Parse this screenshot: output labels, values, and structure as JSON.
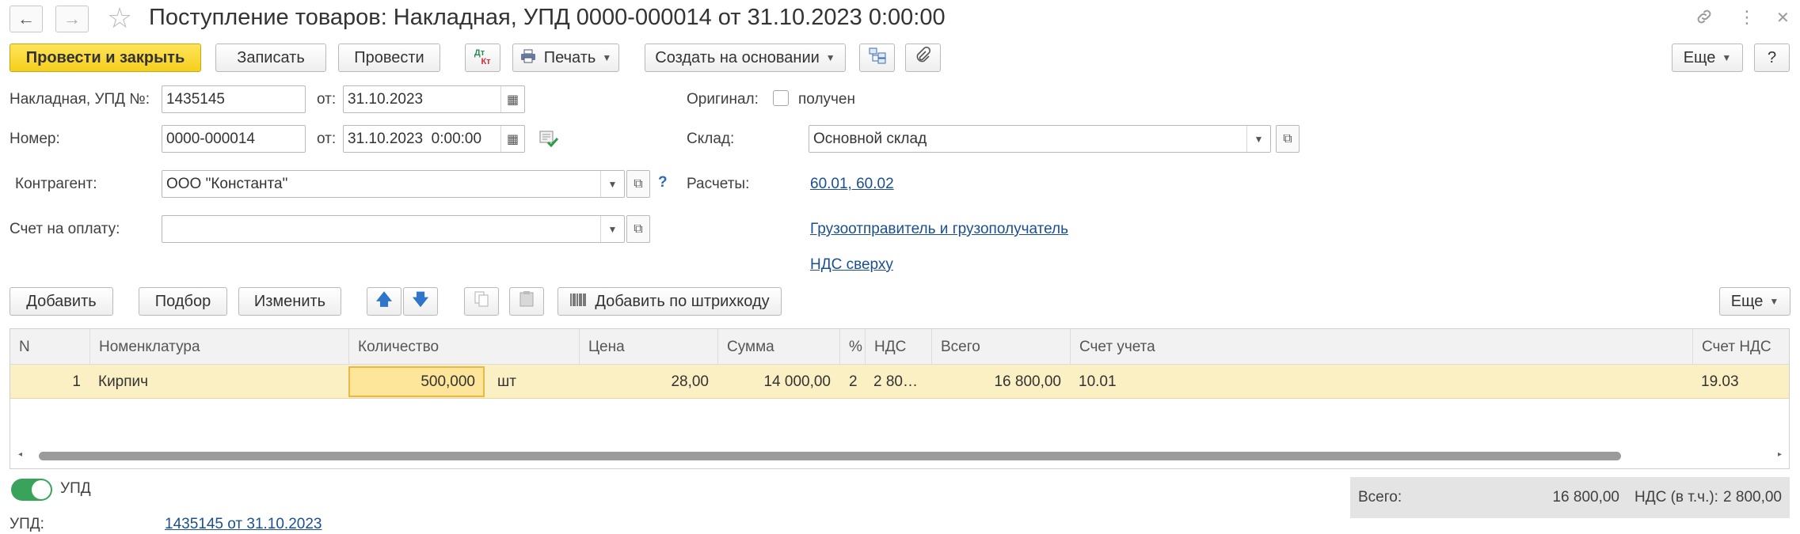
{
  "window": {
    "title": "Поступление товаров: Накладная, УПД 0000-000014 от 31.10.2023 0:00:00",
    "back_icon": "←",
    "forward_icon": "→",
    "star_icon": "☆",
    "link_icon": "🔗",
    "menu_icon": "⋮",
    "close_icon": "✕"
  },
  "toolbar": {
    "post_and_close": "Провести и закрыть",
    "save": "Записать",
    "post": "Провести",
    "dtkt_top": "Дт",
    "dtkt_bottom": "Кт",
    "print": "Печать",
    "create_based_on": "Создать на основании",
    "more": "Еще",
    "help": "?"
  },
  "form": {
    "invoice_label": "Накладная, УПД №:",
    "invoice_number": "1435145",
    "from_label": "от:",
    "invoice_date": "31.10.2023",
    "original_label": "Оригинал:",
    "received_label": "получен",
    "number_label": "Номер:",
    "doc_number": "0000-000014",
    "doc_datetime": "31.10.2023  0:00:00",
    "warehouse_label": "Склад:",
    "warehouse_value": "Основной склад",
    "counterparty_label": "Контрагент:",
    "counterparty_value": "ООО \"Константа\"",
    "help_mark": "?",
    "settlements_label": "Расчеты:",
    "settlements_link": "60.01, 60.02",
    "payment_invoice_label": "Счет на оплату:",
    "payment_invoice_value": "",
    "shipper_link": "Грузоотправитель и грузополучатель",
    "vat_link": "НДС сверху"
  },
  "table_toolbar": {
    "add": "Добавить",
    "pick": "Подбор",
    "change": "Изменить",
    "up_icon": "🡅",
    "down_icon": "🡇",
    "add_by_barcode": "Добавить по штрихкоду",
    "more": "Еще"
  },
  "table": {
    "columns": [
      "N",
      "Номенклатура",
      "Количество",
      "Цена",
      "Сумма",
      "%",
      "НДС",
      "Всего",
      "Счет учета",
      "Счет НДС"
    ],
    "rows": [
      {
        "n": "1",
        "item": "Кирпич",
        "quantity": "500,000",
        "unit": "шт",
        "price": "28,00",
        "sum": "14 000,00",
        "vat_rate": "2",
        "vat": "2 80…",
        "total": "16 800,00",
        "account": "10.01",
        "vat_account": "19.03"
      }
    ]
  },
  "footer": {
    "upd_toggle_label": "УПД",
    "upd_label": "УПД:",
    "upd_link": "1435145 от 31.10.2023",
    "total_label": "Всего:",
    "total_value": "16 800,00",
    "vat_label": "НДС (в т.ч.):",
    "vat_value": "2 800,00"
  }
}
